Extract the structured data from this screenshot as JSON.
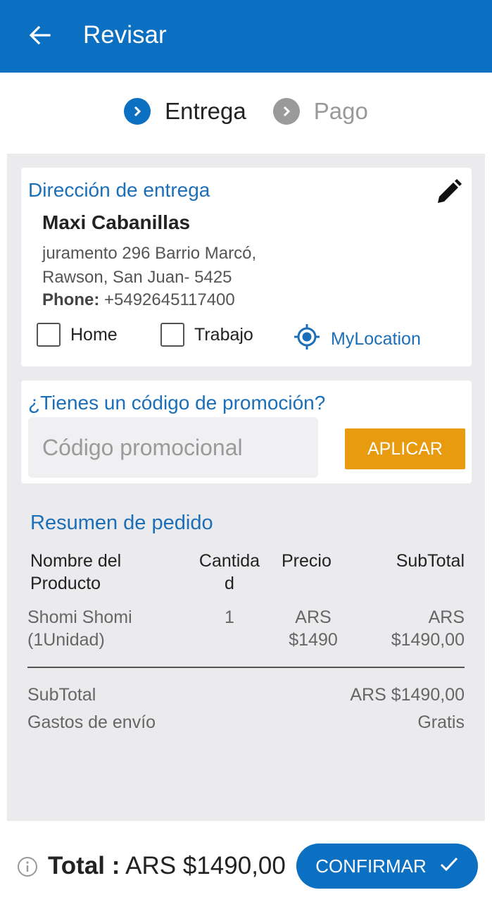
{
  "app_bar": {
    "title": "Revisar",
    "back_icon": "arrow-left-icon"
  },
  "steps": [
    {
      "label": "Entrega",
      "state": "active"
    },
    {
      "label": "Pago",
      "state": "inactive"
    }
  ],
  "address": {
    "section_title": "Dirección de entrega",
    "name": "Maxi Cabanillas",
    "line1": "juramento 296 Barrio Marcó,",
    "line2": "Rawson, San Juan- 5425",
    "phone_label": "Phone:",
    "phone_value": " +5492645117400",
    "options": {
      "home": "Home",
      "work": "Trabajo",
      "location": "MyLocation"
    }
  },
  "promo": {
    "question": "¿Tienes un código de promoción?",
    "placeholder": "Código promocional",
    "apply_label": "APLICAR"
  },
  "summary": {
    "title": "Resumen de pedido",
    "headers": [
      "Nombre del Producto",
      "Cantida d",
      "Precio",
      "SubTotal"
    ],
    "rows": [
      {
        "name": "Shomi Shomi (1Unidad)",
        "qty": "1",
        "price": "ARS $1490",
        "subtotal": "ARS $1490,00"
      }
    ],
    "subtotal_label": "SubTotal",
    "subtotal_value": "ARS $1490,00",
    "shipping_label": "Gastos de envío",
    "shipping_value": "Gratis"
  },
  "footer": {
    "total_label": "Total :",
    "total_value": " ARS $1490,00",
    "confirm_label": "CONFIRMAR"
  },
  "colors": {
    "primary": "#0b6fc2",
    "accent": "#e89b0e",
    "link": "#1b6fb8",
    "background": "#ebebee"
  }
}
